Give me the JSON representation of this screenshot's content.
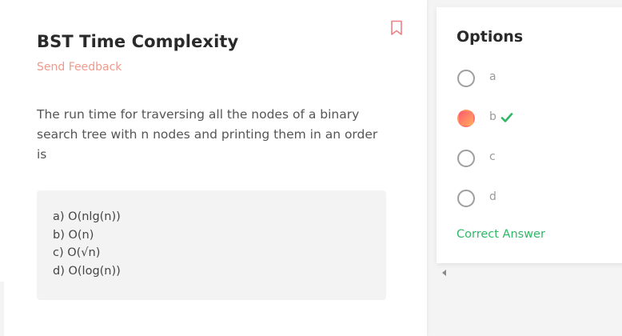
{
  "question": {
    "title": "BST Time Complexity",
    "feedback_link": "Send Feedback",
    "text": "The run time for traversing all the nodes of a binary search tree with n nodes and printing them in an order is",
    "choices": [
      "a)  O(nlg(n))",
      "b)  O(n)",
      "c)  O(√n)",
      "d)  O(log(n))"
    ]
  },
  "options_panel": {
    "title": "Options",
    "options": [
      {
        "label": "a",
        "selected": false
      },
      {
        "label": "b",
        "selected": true,
        "correct": true
      },
      {
        "label": "c",
        "selected": false
      },
      {
        "label": "d",
        "selected": false
      }
    ],
    "result": "Correct Answer"
  },
  "colors": {
    "accent_feedback": "#f09a8c",
    "correct_green": "#2fb865",
    "selected_gradient_start": "#ff5a6e",
    "selected_gradient_end": "#ffae5c"
  },
  "icons": {
    "bookmark": "bookmark-icon",
    "check": "check-icon",
    "scroll_left": "chevron-left-icon"
  }
}
